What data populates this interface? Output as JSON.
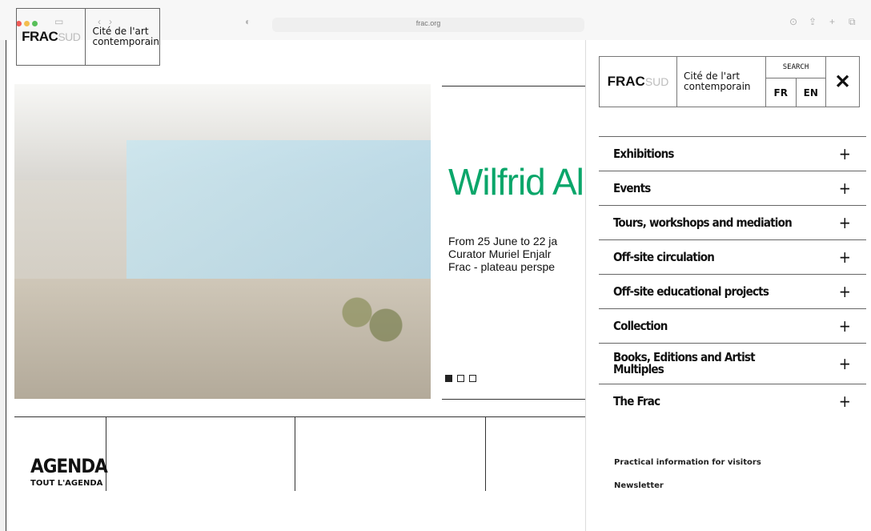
{
  "browser": {
    "url": "frac.org"
  },
  "header": {
    "logo_text": "FRAC",
    "logo_sub": "SUD",
    "tagline_line1": "Cité de l'art",
    "tagline_line2": "contemporain"
  },
  "hero": {
    "title": "Wilfrid Almer",
    "line1": "From 25 June to 22 ja",
    "line2": "Curator Muriel Enjalr",
    "line3": "Frac - plateau perspe"
  },
  "agenda": {
    "title": "AGENDA",
    "subtitle": "TOUT L'AGENDA"
  },
  "overlay": {
    "search_label": "SEARCH",
    "lang_fr": "FR",
    "lang_en": "EN",
    "close_label": "✕",
    "menu": [
      {
        "label": "Exhibitions"
      },
      {
        "label": "Events"
      },
      {
        "label": "Tours, workshops and mediation"
      },
      {
        "label": "Off-site circulation"
      },
      {
        "label": "Off-site educational projects"
      },
      {
        "label": "Collection"
      },
      {
        "label": "Books, Editions and Artist Multiples"
      },
      {
        "label": "The Frac"
      }
    ],
    "practical": "Practical information for visitors",
    "newsletter": "Newsletter"
  }
}
